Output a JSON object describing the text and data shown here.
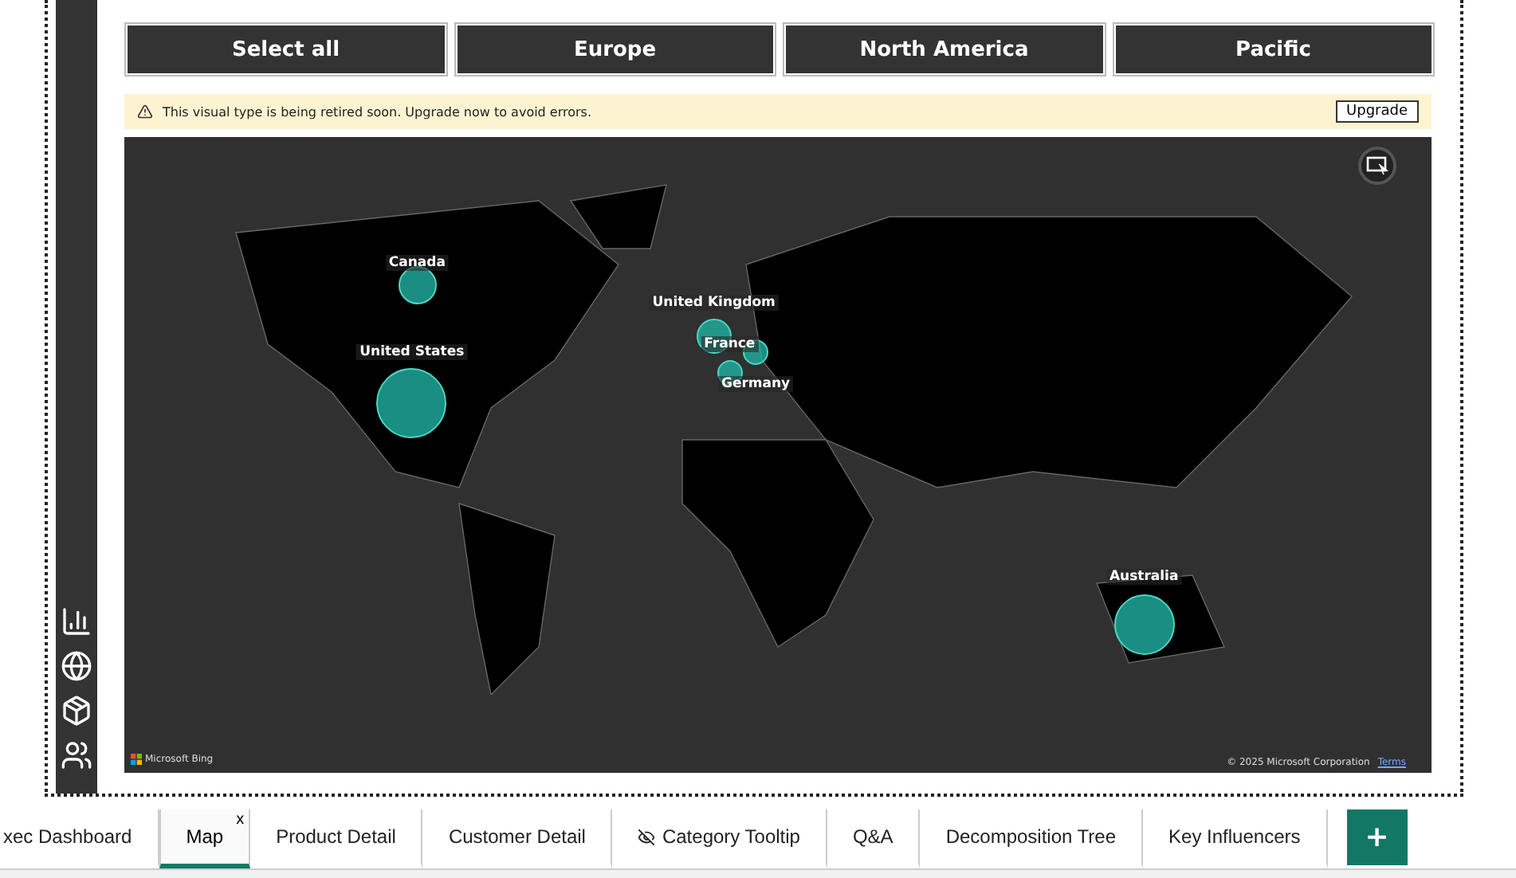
{
  "slicer": [
    {
      "label": "Select all"
    },
    {
      "label": "Europe"
    },
    {
      "label": "North America"
    },
    {
      "label": "Pacific"
    }
  ],
  "banner": {
    "message": "This visual type is being retired soon. Upgrade now to avoid errors.",
    "button": "Upgrade"
  },
  "map": {
    "bubbles": [
      {
        "label": "Canada"
      },
      {
        "label": "United States"
      },
      {
        "label": "United Kingdom"
      },
      {
        "label": "France"
      },
      {
        "label": "Germany"
      },
      {
        "label": "Australia"
      }
    ],
    "logo": "Microsoft Bing",
    "copyright": "© 2025 Microsoft Corporation",
    "terms": "Terms"
  },
  "page_tabs": [
    {
      "label": "xec Dashboard",
      "selected": false,
      "kind": "page"
    },
    {
      "label": "Map",
      "selected": true,
      "kind": "page",
      "close": "x"
    },
    {
      "label": "Product Detail",
      "selected": false,
      "kind": "page"
    },
    {
      "label": "Customer Detail",
      "selected": false,
      "kind": "page"
    },
    {
      "label": "Category Tooltip",
      "selected": false,
      "kind": "hidden"
    },
    {
      "label": "Q&A",
      "selected": false,
      "kind": "page"
    },
    {
      "label": "Decomposition Tree",
      "selected": false,
      "kind": "page"
    },
    {
      "label": "Key Influencers",
      "selected": false,
      "kind": "page"
    }
  ],
  "add_page": "+"
}
